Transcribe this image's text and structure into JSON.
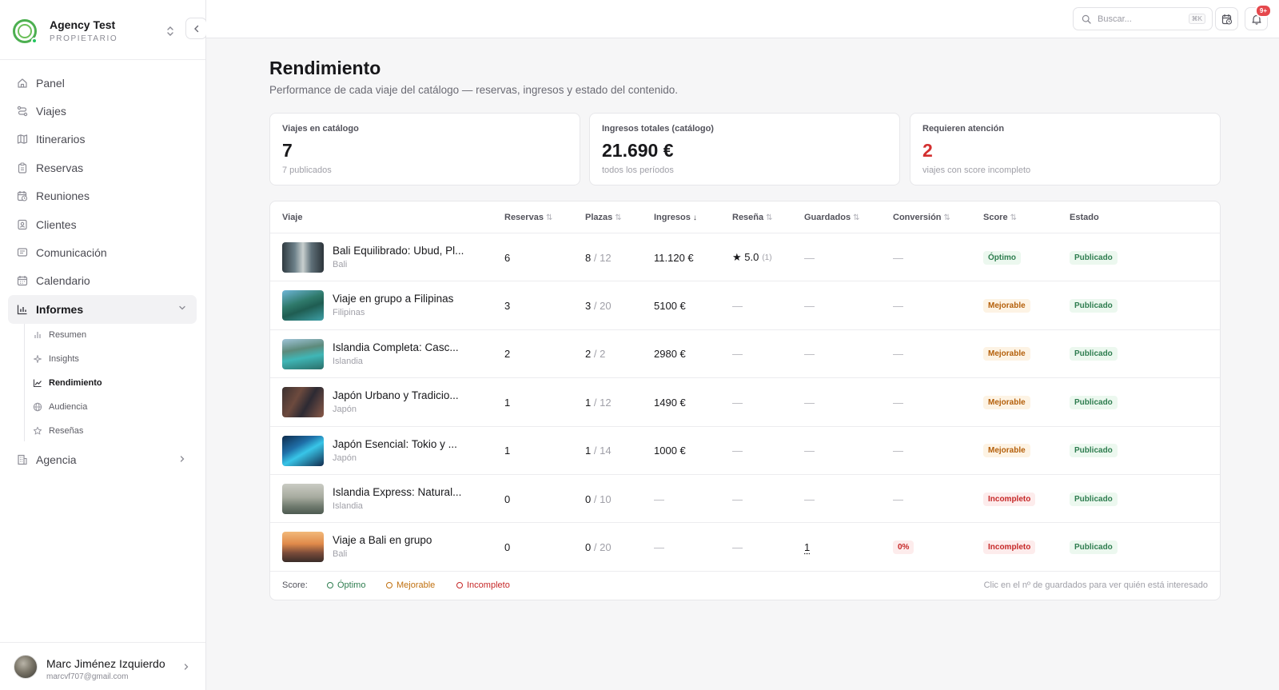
{
  "agency": {
    "name": "Agency Test",
    "role": "PROPIETARIO"
  },
  "nav": [
    {
      "label": "Panel",
      "icon": "home-icon"
    },
    {
      "label": "Viajes",
      "icon": "route-icon"
    },
    {
      "label": "Itinerarios",
      "icon": "map-icon"
    },
    {
      "label": "Reservas",
      "icon": "clipboard-icon"
    },
    {
      "label": "Reuniones",
      "icon": "calendar-clock-icon"
    },
    {
      "label": "Clientes",
      "icon": "contacts-icon"
    },
    {
      "label": "Comunicación",
      "icon": "message-icon"
    },
    {
      "label": "Calendario",
      "icon": "calendar-icon"
    },
    {
      "label": "Informes",
      "icon": "bar-chart-icon"
    },
    {
      "label": "Agencia",
      "icon": "building-icon"
    }
  ],
  "reports_sub": [
    {
      "label": "Resumen",
      "icon": "bars-icon"
    },
    {
      "label": "Insights",
      "icon": "sparkle-icon"
    },
    {
      "label": "Rendimiento",
      "icon": "line-chart-icon"
    },
    {
      "label": "Audiencia",
      "icon": "globe-icon"
    },
    {
      "label": "Reseñas",
      "icon": "star-icon"
    }
  ],
  "user": {
    "name": "Marc Jiménez Izquierdo",
    "email": "marcvf707@gmail.com"
  },
  "topbar": {
    "search_placeholder": "Buscar...",
    "search_shortcut": "⌘K",
    "notifications_badge": "9+"
  },
  "page": {
    "title": "Rendimiento",
    "subtitle": "Performance de cada viaje del catálogo — reservas, ingresos y estado del contenido."
  },
  "cards": [
    {
      "label": "Viajes en catálogo",
      "value": "7",
      "hint": "7 publicados"
    },
    {
      "label": "Ingresos totales (catálogo)",
      "value": "21.690 €",
      "hint": "todos los períodos"
    },
    {
      "label": "Requieren atención",
      "value": "2",
      "hint": "viajes con score incompleto"
    }
  ],
  "table": {
    "columns": [
      "Viaje",
      "Reservas",
      "Plazas",
      "Ingresos",
      "Reseña",
      "Guardados",
      "Conversión",
      "Score",
      "Estado"
    ],
    "rows": [
      {
        "name": "Bali Equilibrado: Ubud, Pl...",
        "dest": "Bali",
        "reservas": "6",
        "plazas": "8",
        "plazas_total": "/ 12",
        "ingresos": "11.120 €",
        "resena": "★ 5.0",
        "resena_count": "(1)",
        "guardados": "—",
        "conversion": "—",
        "score": "Óptimo",
        "score_color": "green",
        "estado": "Publicado",
        "thumb": "temple"
      },
      {
        "name": "Viaje en grupo a Filipinas",
        "dest": "Filipinas",
        "reservas": "3",
        "plazas": "3",
        "plazas_total": "/ 20",
        "ingresos": "5100 €",
        "resena": "—",
        "resena_count": "",
        "guardados": "—",
        "conversion": "—",
        "score": "Mejorable",
        "score_color": "amber",
        "estado": "Publicado",
        "thumb": "lagoon"
      },
      {
        "name": "Islandia Completa: Casc...",
        "dest": "Islandia",
        "reservas": "2",
        "plazas": "2",
        "plazas_total": "/ 2",
        "ingresos": "2980 €",
        "resena": "—",
        "resena_count": "",
        "guardados": "—",
        "conversion": "—",
        "score": "Mejorable",
        "score_color": "amber",
        "estado": "Publicado",
        "thumb": "lake"
      },
      {
        "name": "Japón Urbano y Tradicio...",
        "dest": "Japón",
        "reservas": "1",
        "plazas": "1",
        "plazas_total": "/ 12",
        "ingresos": "1490 €",
        "resena": "—",
        "resena_count": "",
        "guardados": "—",
        "conversion": "—",
        "score": "Mejorable",
        "score_color": "amber",
        "estado": "Publicado",
        "thumb": "street"
      },
      {
        "name": "Japón Esencial: Tokio y ...",
        "dest": "Japón",
        "reservas": "1",
        "plazas": "1",
        "plazas_total": "/ 14",
        "ingresos": "1000 €",
        "resena": "—",
        "resena_count": "",
        "guardados": "—",
        "conversion": "—",
        "score": "Mejorable",
        "score_color": "amber",
        "estado": "Publicado",
        "thumb": "night"
      },
      {
        "name": "Islandia Express: Natural...",
        "dest": "Islandia",
        "reservas": "0",
        "plazas": "0",
        "plazas_total": "/ 10",
        "ingresos": "—",
        "resena": "—",
        "resena_count": "",
        "guardados": "—",
        "conversion": "—",
        "score": "Incompleto",
        "score_color": "red",
        "estado": "Publicado",
        "thumb": "mist"
      },
      {
        "name": "Viaje a Bali en grupo",
        "dest": "Bali",
        "reservas": "0",
        "plazas": "0",
        "plazas_total": "/ 20",
        "ingresos": "—",
        "resena": "—",
        "resena_count": "",
        "guardados": "1",
        "conversion": "0%",
        "score": "Incompleto",
        "score_color": "red",
        "estado": "Publicado",
        "thumb": "sunset"
      }
    ],
    "legend_label": "Score:",
    "legend": [
      {
        "label": "Óptimo",
        "color": "#2e7d4f"
      },
      {
        "label": "Mejorable",
        "color": "#c0700f"
      },
      {
        "label": "Incompleto",
        "color": "#c62828"
      }
    ],
    "footer_note": "Clic en el nº de guardados para ver quién está interesado"
  },
  "colors": {
    "accent_red": "#d32f2f",
    "green": "#2e7d4f",
    "amber": "#b45f0a"
  }
}
